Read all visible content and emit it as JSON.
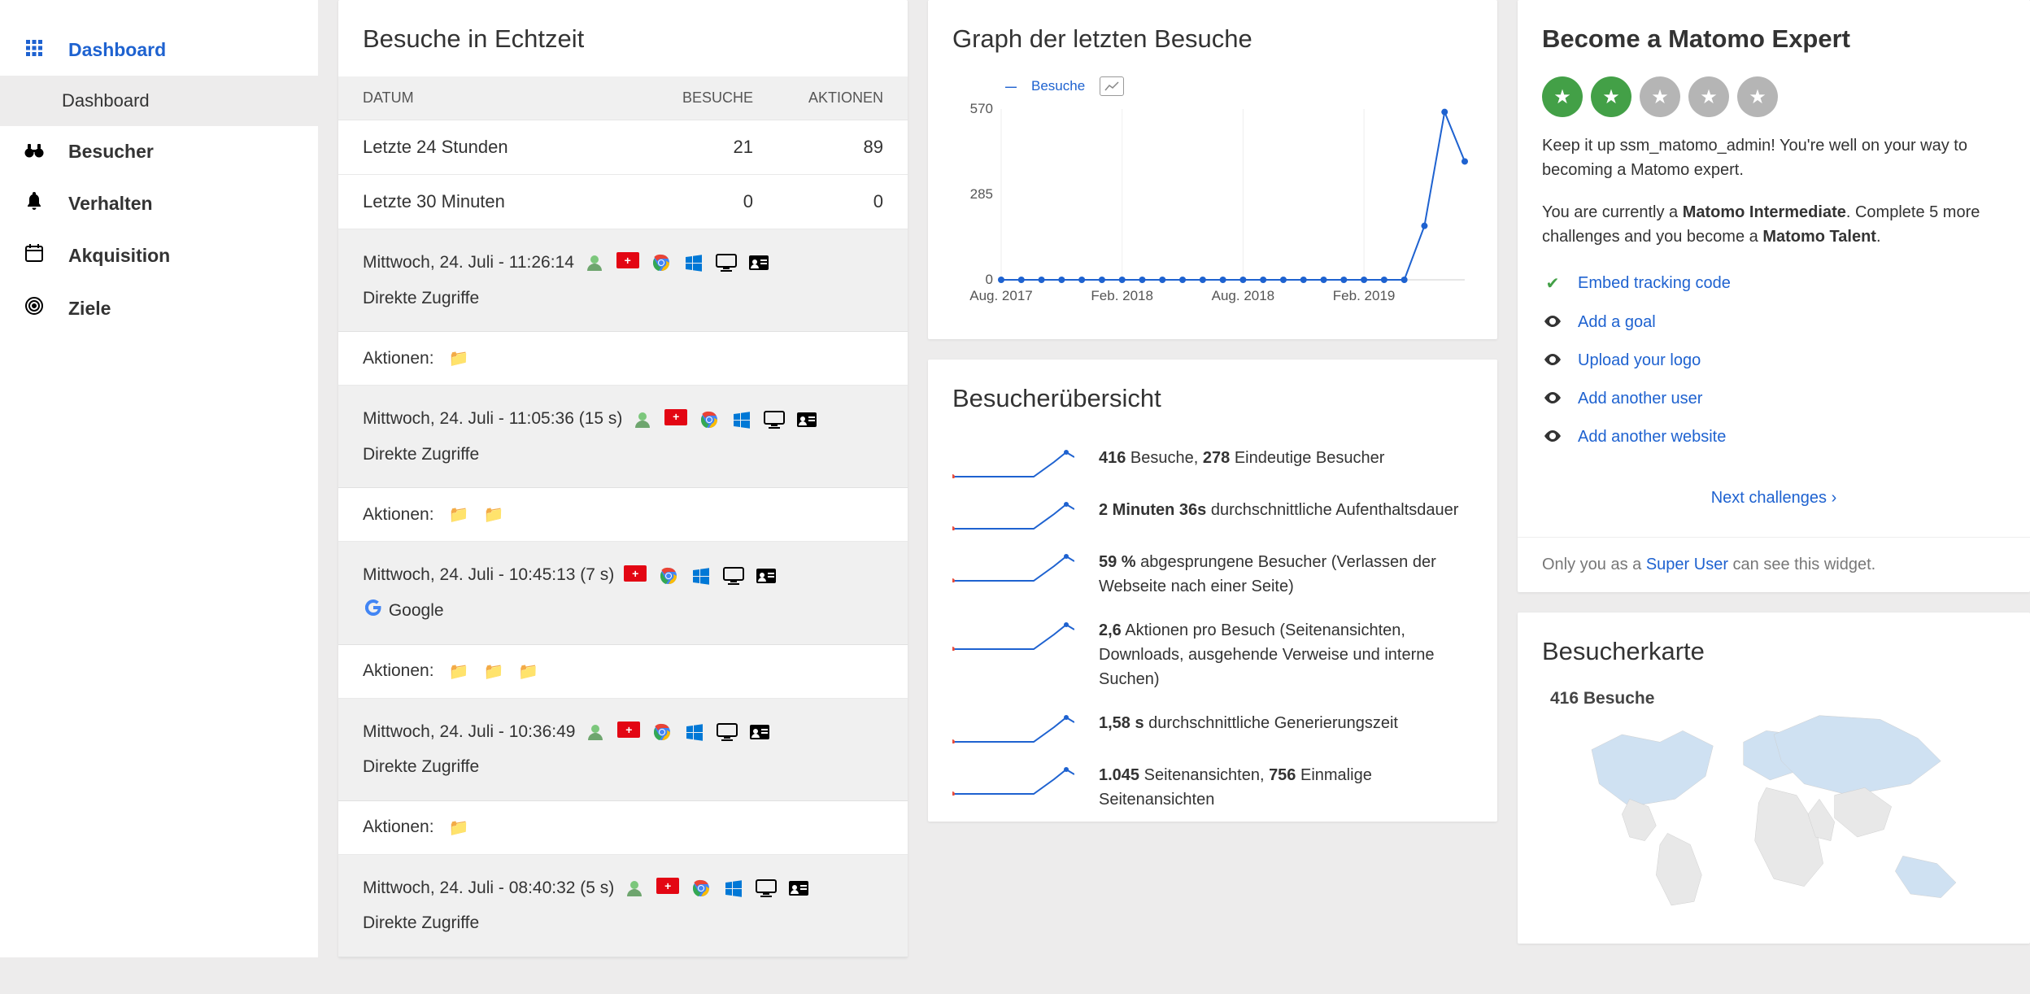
{
  "sidebar": {
    "items": [
      {
        "label": "Dashboard",
        "icon": "⊞",
        "active": true,
        "sub": "Dashboard"
      },
      {
        "label": "Besucher",
        "icon": "binoculars"
      },
      {
        "label": "Verhalten",
        "icon": "bell"
      },
      {
        "label": "Akquisition",
        "icon": "calendar"
      },
      {
        "label": "Ziele",
        "icon": "target"
      }
    ]
  },
  "realtime": {
    "title": "Besuche in Echtzeit",
    "head": {
      "date": "DATUM",
      "visits": "BESUCHE",
      "actions": "AKTIONEN"
    },
    "summary": [
      {
        "label": "Letzte 24 Stunden",
        "visits": "21",
        "actions": "89"
      },
      {
        "label": "Letzte 30 Minuten",
        "visits": "0",
        "actions": "0"
      }
    ],
    "actions_label": "Aktionen:",
    "visits": [
      {
        "time": "Mittwoch, 24. Juli - 11:26:14",
        "duration": "",
        "ref": "Direkte Zugriffe",
        "icons": [
          "user",
          "ch",
          "chrome",
          "win",
          "desktop",
          "card"
        ],
        "folders": 1
      },
      {
        "time": "Mittwoch, 24. Juli - 11:05:36",
        "duration": "(15 s)",
        "ref": "Direkte Zugriffe",
        "icons": [
          "user",
          "ch",
          "chrome",
          "win",
          "desktop",
          "card"
        ],
        "folders": 2
      },
      {
        "time": "Mittwoch, 24. Juli - 10:45:13",
        "duration": "(7 s)",
        "ref": "Google",
        "refIcon": "g",
        "icons": [
          "ch",
          "chrome",
          "win",
          "desktop",
          "card"
        ],
        "folders": 3
      },
      {
        "time": "Mittwoch, 24. Juli - 10:36:49",
        "duration": "",
        "ref": "Direkte Zugriffe",
        "icons": [
          "user",
          "ch",
          "chrome",
          "win",
          "desktop",
          "card"
        ],
        "folders": 1
      },
      {
        "time": "Mittwoch, 24. Juli - 08:40:32",
        "duration": "(5 s)",
        "ref": "Direkte Zugriffe",
        "icons": [
          "user",
          "ch",
          "chrome",
          "win",
          "desktop",
          "card"
        ],
        "folders": 0
      }
    ]
  },
  "chart": {
    "title": "Graph der letzten Besuche",
    "legend": "Besuche"
  },
  "chart_data": {
    "type": "line",
    "title": "Graph der letzten Besuche",
    "xlabel": "",
    "ylabel": "Besuche",
    "ylim": [
      0,
      570
    ],
    "y_ticks": [
      0,
      285,
      570
    ],
    "x_ticks": [
      "Aug. 2017",
      "Feb. 2018",
      "Aug. 2018",
      "Feb. 2019"
    ],
    "x": [
      "2017-08",
      "2017-09",
      "2017-10",
      "2017-11",
      "2017-12",
      "2018-01",
      "2018-02",
      "2018-03",
      "2018-04",
      "2018-05",
      "2018-06",
      "2018-07",
      "2018-08",
      "2018-09",
      "2018-10",
      "2018-11",
      "2018-12",
      "2019-01",
      "2019-02",
      "2019-03",
      "2019-04",
      "2019-05",
      "2019-06",
      "2019-07"
    ],
    "series": [
      {
        "name": "Besuche",
        "values": [
          0,
          0,
          0,
          0,
          0,
          0,
          0,
          0,
          0,
          0,
          0,
          0,
          0,
          0,
          0,
          0,
          0,
          0,
          0,
          0,
          0,
          180,
          560,
          395
        ]
      }
    ]
  },
  "overview": {
    "title": "Besucherübersicht",
    "rows": [
      {
        "b1": "416",
        "t1": " Besuche, ",
        "b2": "278",
        "t2": " Eindeutige Besucher"
      },
      {
        "b1": "2 Minuten 36s",
        "t1": " durchschnittliche Aufenthaltsdauer"
      },
      {
        "b1": "59 %",
        "t1": " abgesprungene Besucher (Verlassen der Webseite nach einer Seite)"
      },
      {
        "b1": "2,6",
        "t1": " Aktionen pro Besuch (Seitenansichten, Downloads, ausgehende Verweise und interne Suchen)"
      },
      {
        "b1": "1,58 s",
        "t1": " durchschnittliche Generierungszeit"
      },
      {
        "b1": "1.045",
        "t1": " Seitenansichten, ",
        "b2": "756",
        "t2": " Einmalige Seitenansichten"
      }
    ]
  },
  "expert": {
    "title": "Become a Matomo Expert",
    "stars_filled": 2,
    "stars_total": 5,
    "p1a": "Keep it up ssm_matomo_admin! You're well on your way to becoming a Matomo expert.",
    "p2a": "You are currently a ",
    "p2b": "Matomo Intermediate",
    "p2c": ". Complete 5 more challenges and you become a ",
    "p2d": "Matomo Talent",
    "p2e": ".",
    "tasks": [
      {
        "done": true,
        "label": "Embed tracking code"
      },
      {
        "done": false,
        "label": "Add a goal"
      },
      {
        "done": false,
        "label": "Upload your logo"
      },
      {
        "done": false,
        "label": "Add another user"
      },
      {
        "done": false,
        "label": "Add another website"
      }
    ],
    "next": "Next challenges ›",
    "footer_a": "Only you as a ",
    "footer_b": "Super User",
    "footer_c": " can see this widget."
  },
  "map": {
    "title": "Besucherkarte",
    "label": "416 Besuche"
  }
}
